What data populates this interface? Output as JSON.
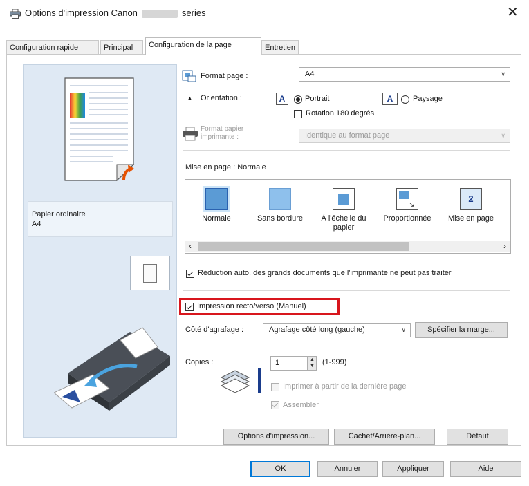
{
  "window": {
    "title_prefix": "Options d'impression Canon",
    "title_suffix": "series",
    "icon": "printer-icon",
    "close_icon": "close-icon"
  },
  "tabs": [
    {
      "label": "Configuration rapide",
      "active": false
    },
    {
      "label": "Principal",
      "active": false
    },
    {
      "label": "Configuration de la page",
      "active": true
    },
    {
      "label": "Entretien",
      "active": false
    }
  ],
  "preview": {
    "paper_type": "Papier ordinaire",
    "paper_size": "A4"
  },
  "page_size": {
    "label": "Format page :",
    "value": "A4",
    "icon": "page-size-icon"
  },
  "orientation": {
    "label": "Orientation :",
    "portrait": "Portrait",
    "landscape": "Paysage",
    "portrait_selected": true,
    "rotate_label": "Rotation 180 degrés",
    "rotate_checked": false
  },
  "printer_paper": {
    "label_line1": "Format papier",
    "label_line2": "imprimante :",
    "value": "Identique au format page",
    "disabled": true
  },
  "layout": {
    "label": "Mise en page : Normale",
    "items": [
      {
        "label": "Normale",
        "icon": "normal-layout-icon",
        "selected": true
      },
      {
        "label": "Sans bordure",
        "icon": "borderless-layout-icon",
        "selected": false
      },
      {
        "label": "À l'échelle du papier",
        "icon": "fit-to-page-icon",
        "selected": false
      },
      {
        "label": "Proportionnée",
        "icon": "scaled-layout-icon",
        "selected": false
      },
      {
        "label": "Mise en page",
        "icon": "page-layout-icon",
        "selected": false
      }
    ],
    "page_layout_number": "2"
  },
  "auto_reduce": {
    "label": "Réduction auto. des grands documents que l'imprimante ne peut pas traiter",
    "checked": true
  },
  "duplex": {
    "label": "Impression recto/verso (Manuel)",
    "checked": true,
    "highlight_color": "#d8161d"
  },
  "stapling": {
    "label": "Côté d'agrafage :",
    "value": "Agrafage côté long (gauche)",
    "margin_button": "Spécifier la marge..."
  },
  "copies": {
    "label": "Copies :",
    "value": "1",
    "range": "(1-999)",
    "reverse_label": "Imprimer à partir de la dernière page",
    "reverse_checked": false,
    "collate_label": "Assembler",
    "collate_checked": true,
    "icon": "copies-stack-icon"
  },
  "panel_buttons": {
    "print_options": "Options d'impression...",
    "stamp": "Cachet/Arrière-plan...",
    "defaults": "Défaut"
  },
  "dialog_buttons": {
    "ok": "OK",
    "cancel": "Annuler",
    "apply": "Appliquer",
    "help": "Aide"
  },
  "colors": {
    "accent": "#0078d7",
    "preview_bg": "#dfe9f4",
    "layout_icon": "#5b9bd5"
  }
}
